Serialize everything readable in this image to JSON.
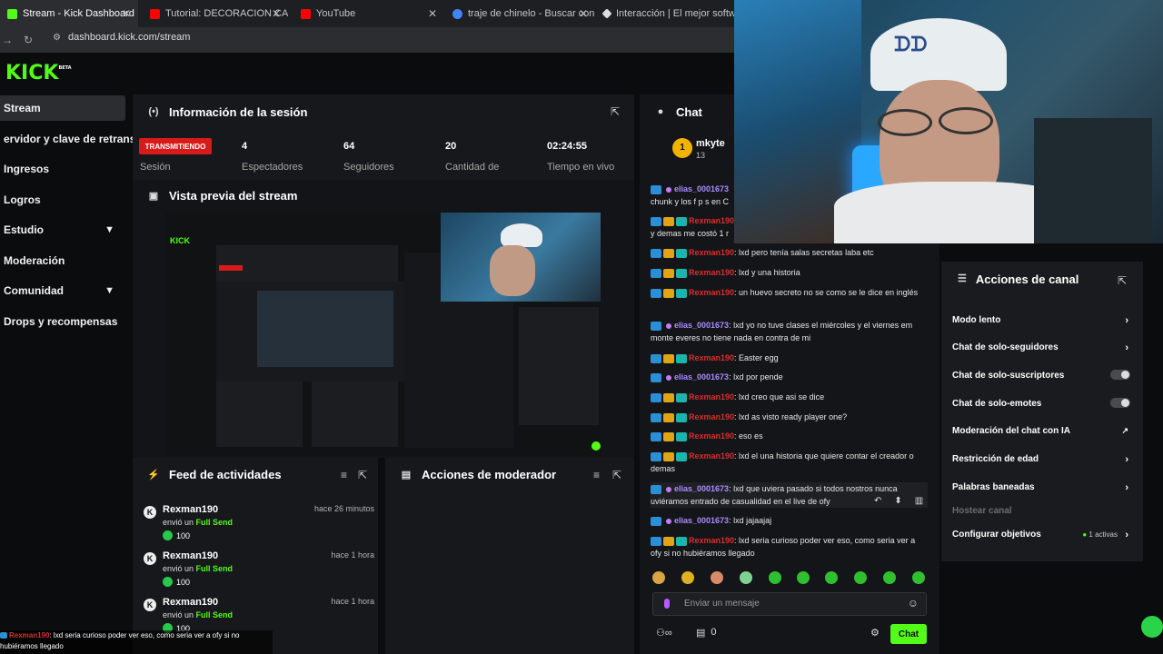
{
  "browser": {
    "tabs": [
      {
        "title": "Stream - Kick Dashboard",
        "color": "#53fc18"
      },
      {
        "title": "Tutorial: DECORACION CASTILL",
        "color": "#ff0000"
      },
      {
        "title": "YouTube",
        "color": "#ff0000"
      },
      {
        "title": "traje de chinelo - Buscar con G",
        "color": "#4285f4"
      },
      {
        "title": "Interacción | El mejor software",
        "color": "#dddddd"
      }
    ],
    "url": "dashboard.kick.com/stream"
  },
  "brand": {
    "logo": "KICK",
    "beta": "BETA"
  },
  "nav": [
    {
      "label": "Stream",
      "selected": true
    },
    {
      "label": "ervidor y clave de retransmisión"
    },
    {
      "label": "Ingresos"
    },
    {
      "label": "Logros"
    },
    {
      "label": "Estudio",
      "chevron": true
    },
    {
      "label": "Moderación"
    },
    {
      "label": "Comunidad",
      "chevron": true
    },
    {
      "label": "Drops y recompensas"
    }
  ],
  "session": {
    "title": "Información de la sesión",
    "status": "TRANSMITIENDO",
    "status_label": "Sesión",
    "stats": [
      {
        "value": "4",
        "label": "Espectadores"
      },
      {
        "value": "64",
        "label": "Seguidores"
      },
      {
        "value": "20",
        "label": "Cantidad de"
      },
      {
        "value": "02:24:55",
        "label": "Tiempo en vivo"
      }
    ]
  },
  "preview": {
    "title": "Vista previa del stream"
  },
  "feed": {
    "title": "Feed de actividades",
    "items": [
      {
        "user": "Rexman190",
        "time": "hace 26 minutos",
        "action": "envió un",
        "item": "Full Send",
        "amount": "100"
      },
      {
        "user": "Rexman190",
        "time": "hace 1 hora",
        "action": "envió un",
        "item": "Full Send",
        "amount": "100"
      },
      {
        "user": "Rexman190",
        "time": "hace 1 hora",
        "action": "envió un",
        "item": "Full Send",
        "amount": "100"
      }
    ]
  },
  "modactions": {
    "title": "Acciones de moderador"
  },
  "chat": {
    "title": "Chat",
    "pinned_user": "mkyte",
    "pinned_count": "13",
    "messages": [
      {
        "user": "elias_0001673",
        "text": "chunk y los f p s en C",
        "type": "pur"
      },
      {
        "user": "Rexman190",
        "text": "y demas me costó 1 r",
        "type": "red"
      },
      {
        "user": "Rexman190",
        "text": ": lxd pero tenía salas secretas laba etc",
        "type": "red"
      },
      {
        "user": "Rexman190",
        "text": ": lxd y una historia",
        "type": "red"
      },
      {
        "user": "Rexman190",
        "text": ": un huevo secreto no se como se le dice en inglés",
        "type": "red"
      },
      {
        "user": "elias_0001673",
        "text": ": lxd yo no tuve clases el miércoles y el viernes em monte everes no tiene nada en contra de mi",
        "type": "pur"
      },
      {
        "user": "Rexman190",
        "text": ": Easter egg",
        "type": "red"
      },
      {
        "user": "elias_0001673",
        "text": ": lxd por pende",
        "type": "pur"
      },
      {
        "user": "Rexman190",
        "text": ": lxd creo que asi se dice",
        "type": "red"
      },
      {
        "user": "Rexman190",
        "text": ": lxd as visto ready player one?",
        "type": "red"
      },
      {
        "user": "Rexman190",
        "text": ": eso es",
        "type": "red"
      },
      {
        "user": "Rexman190",
        "text": ": lxd el una historia que quiere contar el creador o demas",
        "type": "red"
      },
      {
        "user": "elias_0001673",
        "text": ": lxd que uviera pasado si todos nostros nunca uviéramos entrado de casualidad en el live de ofy",
        "type": "pur"
      },
      {
        "user": "elias_0001673",
        "text": ": lxd jajaajaj",
        "type": "pur"
      },
      {
        "user": "Rexman190",
        "text": ": lxd seria curioso poder ver eso, como seria ver a ofy si no hubiéramos llegado",
        "type": "red"
      }
    ],
    "input_placeholder": "Enviar un mensaje",
    "points": "0",
    "send_label": "Chat"
  },
  "channel_actions": {
    "title": "Acciones de canal",
    "rows": [
      {
        "label": "Modo lento",
        "kind": "chevron"
      },
      {
        "label": "Chat de solo-seguidores",
        "kind": "chevron"
      },
      {
        "label": "Chat de solo-suscriptores",
        "kind": "toggle"
      },
      {
        "label": "Chat de solo-emotes",
        "kind": "toggle"
      },
      {
        "label": "Moderación del chat con IA",
        "kind": "external"
      },
      {
        "label": "Restricción de edad",
        "kind": "chevron"
      },
      {
        "label": "Palabras baneadas",
        "kind": "chevron"
      },
      {
        "label": "Hostear canal",
        "kind": "disabled"
      },
      {
        "label": "Configurar objetivos",
        "kind": "chevron",
        "badge": "1 activas"
      }
    ]
  },
  "overlay_message": {
    "user": "Rexman190",
    "text": ": lxd seria curioso poder ver eso, como seria ver a ofy si no hubiéramos llegado"
  }
}
